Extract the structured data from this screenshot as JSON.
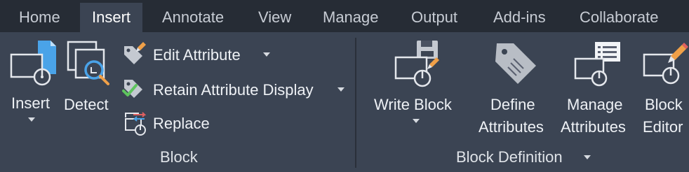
{
  "tabs": [
    "Home",
    "Insert",
    "Annotate",
    "View",
    "Manage",
    "Output",
    "Add-ins",
    "Collaborate"
  ],
  "block_panel": {
    "title": "Block",
    "insert_label": "Insert",
    "detect_label": "Detect",
    "edit_attribute_label": "Edit Attribute",
    "retain_attribute_label": "Retain Attribute Display",
    "replace_label": "Replace"
  },
  "definition_panel": {
    "title": "Block Definition",
    "write_block_label": "Write Block",
    "define_attributes_line1": "Define",
    "define_attributes_line2": "Attributes",
    "manage_attributes_line1": "Manage",
    "manage_attributes_line2": "Attributes",
    "block_editor_line1": "Block",
    "block_editor_line2": "Editor"
  },
  "colors": {
    "tabbar_bg": "#262c35",
    "ribbon_bg": "#3b4453",
    "accent_blue": "#4aa3e8",
    "accent_orange": "#f0a048",
    "accent_green": "#5ec45e"
  },
  "icons": {
    "insert": "insert-block-icon",
    "detect": "detect-block-icon",
    "edit_attribute": "edit-attribute-icon",
    "retain_attribute": "retain-attribute-icon",
    "replace": "replace-block-icon",
    "write_block": "write-block-icon",
    "define_attributes": "tag-icon",
    "manage_attributes": "manage-attributes-icon",
    "block_editor": "block-editor-icon"
  }
}
